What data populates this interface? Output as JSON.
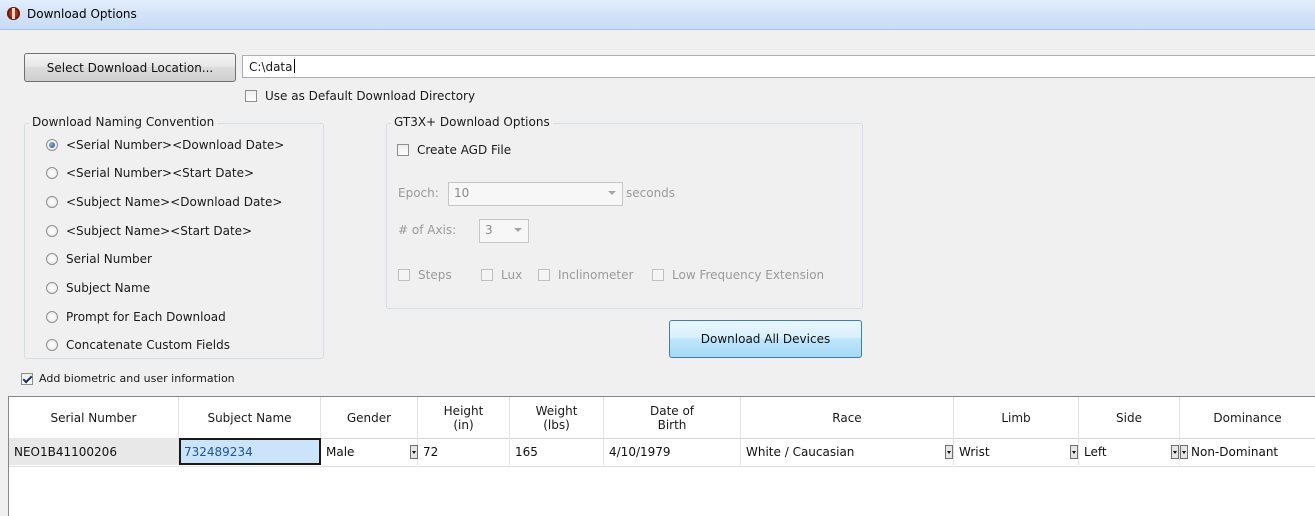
{
  "window": {
    "title": "Download Options"
  },
  "location": {
    "button_label": "Select Download Location...",
    "path_value": "C:\\data",
    "default_dir_label": "Use as Default Download Directory",
    "default_dir_checked": false
  },
  "naming": {
    "legend": "Download Naming Convention",
    "options": [
      {
        "label": "<Serial Number><Download Date>",
        "selected": true
      },
      {
        "label": "<Serial Number><Start Date>",
        "selected": false
      },
      {
        "label": "<Subject Name><Download Date>",
        "selected": false
      },
      {
        "label": "<Subject Name><Start Date>",
        "selected": false
      },
      {
        "label": "Serial Number",
        "selected": false
      },
      {
        "label": "Subject Name",
        "selected": false
      },
      {
        "label": "Prompt for Each Download",
        "selected": false
      },
      {
        "label": "Concatenate Custom Fields",
        "selected": false
      }
    ]
  },
  "gt3x": {
    "legend": "GT3X+ Download Options",
    "create_agd_label": "Create AGD File",
    "epoch_label": "Epoch:",
    "epoch_value": "10",
    "epoch_unit": "seconds",
    "axis_label": "# of Axis:",
    "axis_value": "3",
    "options": [
      "Steps",
      "Lux",
      "Inclinometer",
      "Low Frequency Extension"
    ]
  },
  "download_all_label": "Download All Devices",
  "biometric": {
    "label": "Add biometric and user information",
    "checked": true
  },
  "grid": {
    "headers": [
      "Serial Number",
      "Subject Name",
      "Gender",
      "Height\n(in)",
      "Weight\n(lbs)",
      "Date of\nBirth",
      "Race",
      "Limb",
      "Side",
      "Dominance"
    ],
    "rows": [
      [
        "NEO1B41100206",
        "732489234",
        "Male",
        "72",
        "165",
        "4/10/1979",
        "White / Caucasian",
        "Wrist",
        "Left",
        "Non-Dominant"
      ]
    ]
  }
}
